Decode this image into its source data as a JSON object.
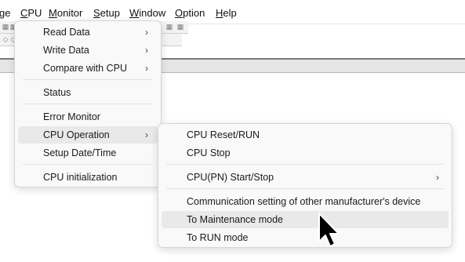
{
  "menubar": {
    "items": [
      {
        "label": "ge"
      },
      {
        "label": "CPU",
        "mnemonic": "C",
        "rest": "PU"
      },
      {
        "label": "Monitor",
        "mnemonic": "M",
        "rest": "onitor"
      },
      {
        "label": "Setup",
        "mnemonic": "S",
        "rest": "etup"
      },
      {
        "label": "Window",
        "mnemonic": "W",
        "rest": "indow"
      },
      {
        "label": "Option",
        "mnemonic": "O",
        "rest": "ption"
      },
      {
        "label": "Help",
        "mnemonic": "H",
        "rest": "elp"
      }
    ]
  },
  "cpu_menu": {
    "items": [
      {
        "label": "Read Data",
        "submenu": true
      },
      {
        "label": "Write Data",
        "submenu": true
      },
      {
        "label": "Compare with CPU",
        "submenu": true
      },
      {
        "label": "Status",
        "submenu": false
      },
      {
        "label": "Error Monitor",
        "submenu": false
      },
      {
        "label": "CPU Operation",
        "submenu": true,
        "highlighted": true
      },
      {
        "label": "Setup Date/Time",
        "submenu": false
      },
      {
        "label": "CPU initialization",
        "submenu": false
      }
    ],
    "arrow_glyph": "›"
  },
  "cpu_operation_submenu": {
    "items": [
      {
        "label": "CPU Reset/RUN",
        "submenu": false
      },
      {
        "label": "CPU Stop",
        "submenu": false
      },
      {
        "label": "CPU(PN) Start/Stop",
        "submenu": true
      },
      {
        "label": "Communication setting of other manufacturer's device",
        "submenu": false
      },
      {
        "label": "To Maintenance mode",
        "submenu": false,
        "highlighted": true
      },
      {
        "label": "To RUN mode",
        "submenu": false
      }
    ],
    "arrow_glyph": "›"
  },
  "colors": {
    "menu_bg": "#f9f9f9",
    "highlight": "#e9e9e9",
    "text": "#1a1a1a"
  }
}
